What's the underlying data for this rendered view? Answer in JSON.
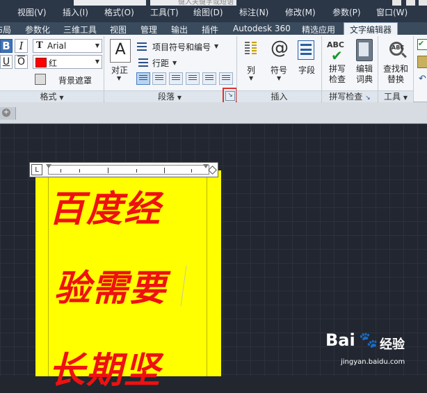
{
  "menubar": {
    "items": [
      "视图(V)",
      "插入(I)",
      "格式(O)",
      "工具(T)",
      "绘图(D)",
      "标注(N)",
      "修改(M)",
      "参数(P)",
      "窗口(W)"
    ],
    "search_placeholder": "键入关键字或短语"
  },
  "ribbon_tabs": [
    "布局",
    "参数化",
    "三维工具",
    "视图",
    "管理",
    "输出",
    "插件",
    "Autodesk 360",
    "精选应用",
    "文字编辑器"
  ],
  "active_tab": "文字编辑器",
  "format_panel": {
    "title": "格式",
    "bold": "B",
    "italic": "I",
    "underline": "U",
    "overline": "O",
    "font_value": "Arial",
    "color_value": "红",
    "color_hex": "#ff0000",
    "background_mask": "背景遮罩"
  },
  "paragraph_panel": {
    "title": "段落",
    "justify": "对正",
    "bullets": "项目符号和编号",
    "line_spacing": "行距"
  },
  "insert_panel": {
    "title": "插入",
    "columns": "列",
    "symbol": "符号",
    "field": "字段"
  },
  "spellcheck_panel": {
    "title": "拼写检查",
    "spell_check": [
      "拼写",
      "检查"
    ],
    "edit_dictionary": [
      "编辑",
      "词典"
    ]
  },
  "tools_panel": {
    "title": "工具",
    "find_replace": [
      "查找和",
      "替换"
    ]
  },
  "editor": {
    "lines": [
      "百度经",
      "验需要",
      "长期坚"
    ],
    "text_color": "#ee1111",
    "background_color": "#ffff00",
    "ruler_tab": "L"
  },
  "watermark": {
    "brand": "Bai",
    "brand_suffix": "经验",
    "url": "jingyan.baidu.com"
  }
}
